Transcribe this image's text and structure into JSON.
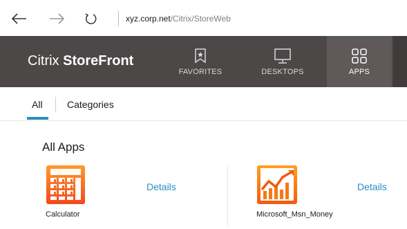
{
  "browser": {
    "url_host": "xyz.corp.net",
    "url_path": "/Citrix/StoreWeb",
    "icons": [
      "back-arrow-icon",
      "forward-arrow-icon",
      "refresh-icon"
    ]
  },
  "header": {
    "brand_light": "Citrix ",
    "brand_bold": "StoreFront",
    "tabs": [
      {
        "label": "FAVORITES",
        "icon": "bookmark-icon",
        "active": false
      },
      {
        "label": "DESKTOPS",
        "icon": "monitor-icon",
        "active": false
      },
      {
        "label": "APPS",
        "icon": "apps-grid-icon",
        "active": true
      }
    ],
    "colors": {
      "header_bg": "#4d4848",
      "active_tab_bg": "#5f5959"
    }
  },
  "subnav": {
    "tabs": [
      {
        "label": "All",
        "active": true
      },
      {
        "label": "Categories",
        "active": false
      }
    ],
    "accent": "#2c8cbf"
  },
  "main": {
    "section_title": "All Apps",
    "apps": [
      {
        "name": "Calculator",
        "details_label": "Details",
        "icon": "calculator-icon"
      },
      {
        "name": "Microsoft_Msn_Money",
        "details_label": "Details",
        "icon": "money-chart-icon"
      }
    ]
  }
}
